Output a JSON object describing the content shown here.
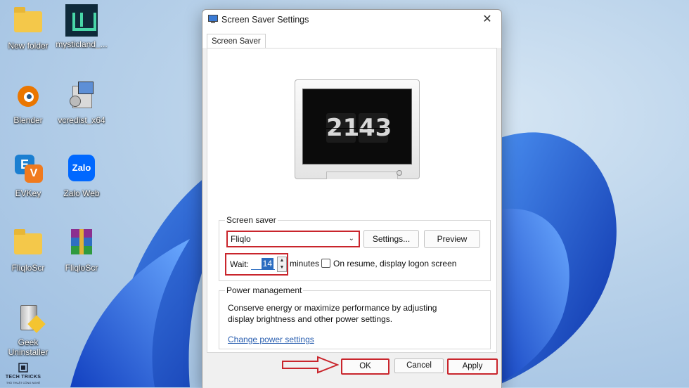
{
  "dialog": {
    "title": "Screen Saver Settings",
    "close_glyph": "✕",
    "tab": "Screen Saver",
    "preview": {
      "hours": "21",
      "minutes": "43"
    },
    "screensaver_group": {
      "label": "Screen saver",
      "selected": "Fliqlo",
      "settings_button": "Settings...",
      "preview_button": "Preview",
      "wait_label": "Wait:",
      "wait_value": "14",
      "minutes_label": "minutes",
      "resume_label": "On resume, display logon screen"
    },
    "power_group": {
      "label": "Power management",
      "description": "Conserve energy or maximize performance by adjusting display brightness and other power settings.",
      "link": "Change power settings"
    },
    "buttons": {
      "ok": "OK",
      "cancel": "Cancel",
      "apply": "Apply"
    }
  },
  "desktop": {
    "icons": [
      {
        "label": "New folder",
        "icon": "folder-icon"
      },
      {
        "label": "mysticland_...",
        "icon": "app-icon"
      },
      {
        "label": "Blender",
        "icon": "blender-icon"
      },
      {
        "label": "vcredist_x64",
        "icon": "installer-icon"
      },
      {
        "label": "EVKey",
        "icon": "evkey-icon"
      },
      {
        "label": "Zalo Web",
        "icon": "zalo-icon"
      },
      {
        "label": "FliqloScr",
        "icon": "folder-icon"
      },
      {
        "label": "FliqloScr",
        "icon": "winrar-icon"
      },
      {
        "label": "Geek Uninstaller",
        "icon": "uninstaller-icon"
      }
    ],
    "watermark": {
      "title": "TECH TRICKS",
      "subtitle": "THỦ THUẬT CÔNG NGHỆ"
    }
  },
  "colors": {
    "highlight_red": "#c9252c",
    "accent_blue": "#2a6cc0",
    "link_blue": "#2a5fb0"
  }
}
